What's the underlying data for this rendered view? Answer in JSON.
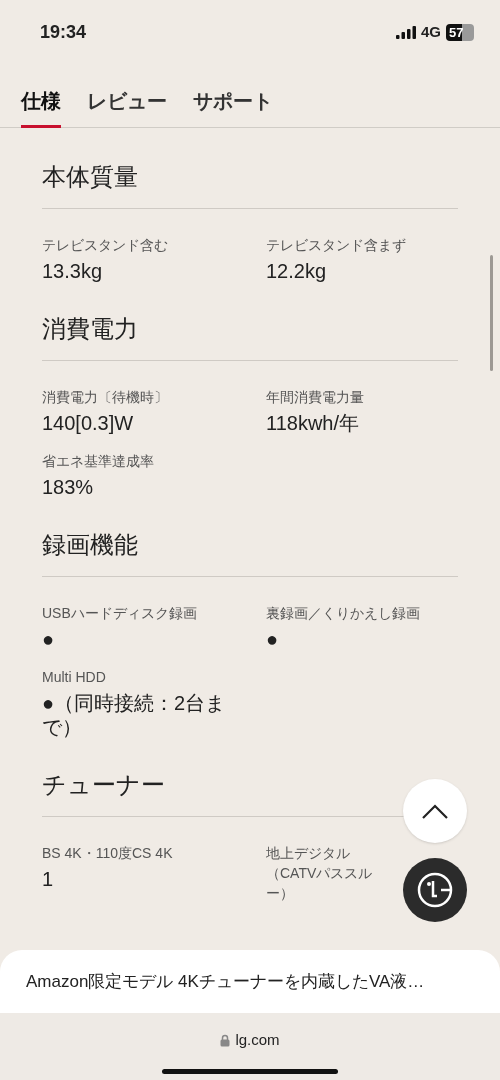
{
  "status_bar": {
    "time": "19:34",
    "network": "4G",
    "battery": "57"
  },
  "tabs": [
    {
      "label": "仕様",
      "selected": true
    },
    {
      "label": "レビュー",
      "selected": false
    },
    {
      "label": "サポート",
      "selected": false
    }
  ],
  "sections": [
    {
      "title": "本体質量",
      "specs": [
        {
          "label": "テレビスタンド含む",
          "value": "13.3kg"
        },
        {
          "label": "テレビスタンド含まず",
          "value": "12.2kg"
        }
      ]
    },
    {
      "title": "消費電力",
      "specs": [
        {
          "label": "消費電力〔待機時〕",
          "value": "140[0.3]W"
        },
        {
          "label": "年間消費電力量",
          "value": "118kwh/年"
        },
        {
          "label": "省エネ基準達成率",
          "value": "183%"
        }
      ]
    },
    {
      "title": "録画機能",
      "specs": [
        {
          "label": "USBハードディスク録画",
          "value": "●"
        },
        {
          "label": "裏録画／くりかえし録画",
          "value": "●"
        },
        {
          "label": "Multi HDD",
          "value": "●（同時接続：2台まで）"
        }
      ]
    },
    {
      "title": "チューナー",
      "specs": [
        {
          "label": "BS 4K・110度CS 4K",
          "value": "1"
        },
        {
          "label": "地上デジタル（CATVパススルー）"
        }
      ]
    }
  ],
  "bottom_sheet": {
    "title": "Amazon限定モデル 4Kチューナーを内蔵したVA液…"
  },
  "browser": {
    "url": "lg.com"
  }
}
